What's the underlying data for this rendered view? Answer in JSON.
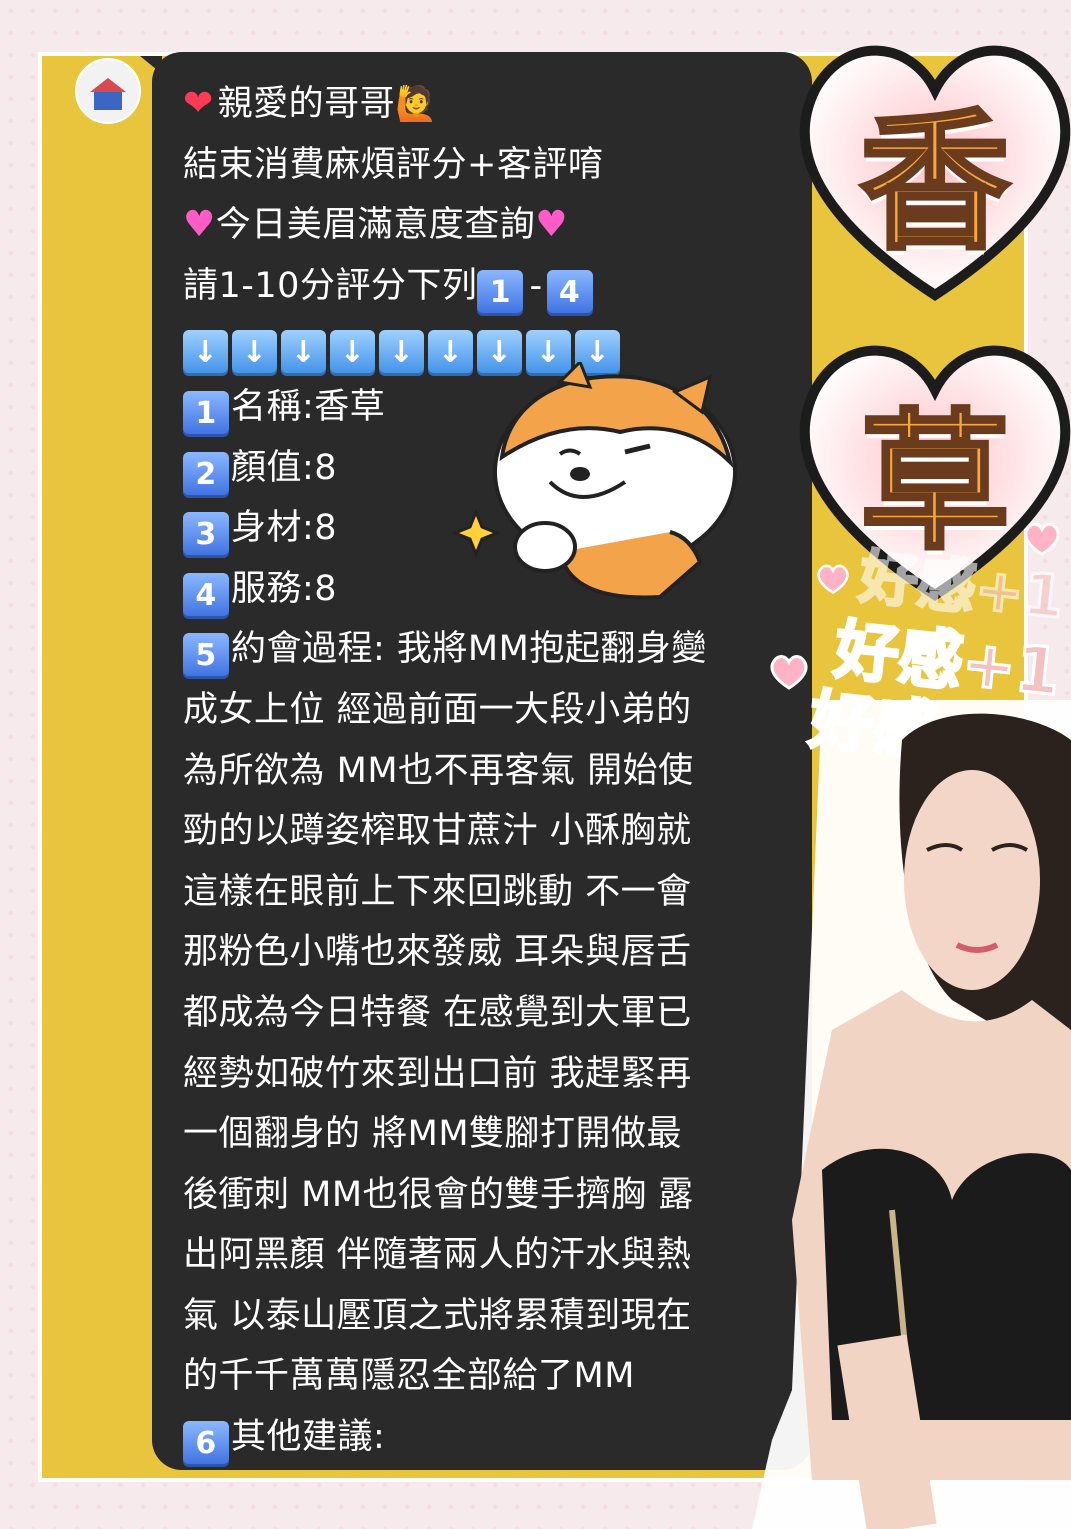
{
  "message": {
    "greeting": "親愛的哥哥",
    "line2": "結束消費麻煩評分+客評唷",
    "line3": "今日美眉滿意度查詢",
    "rating_prompt": "請1-10分評分下列",
    "rating_range_start": "1",
    "rating_range_end": "4",
    "items": [
      {
        "num": "1",
        "text": "名稱:香草"
      },
      {
        "num": "2",
        "text": "顏值:8"
      },
      {
        "num": "3",
        "text": "身材:8"
      },
      {
        "num": "4",
        "text": "服務:8"
      }
    ],
    "item5_num": "5",
    "item5_lines": [
      "約會過程: 我將MM抱起翻身變",
      "成女上位 經過前面一大段小弟的",
      "為所欲為 MM也不再客氣 開始使",
      "勁的以蹲姿榨取甘蔗汁 小酥胸就",
      "這樣在眼前上下來回跳動 不一會",
      "那粉色小嘴也來發威 耳朵與唇舌",
      "都成為今日特餐 在感覺到大軍已",
      "經勢如破竹來到出口前 我趕緊再",
      "一個翻身的 將MM雙腳打開做最",
      "後衝刺 MM也很會的雙手擠胸 露",
      "出阿黑顏 伴隨著兩人的汗水與熱",
      "氣 以泰山壓頂之式將累積到現在",
      "的千千萬萬隱忍全部給了MM"
    ],
    "item6_num": "6",
    "item6_text": "其他建議:"
  },
  "stickers": {
    "name_char_1": "香",
    "name_char_2": "草",
    "like_text": "好感+1"
  }
}
